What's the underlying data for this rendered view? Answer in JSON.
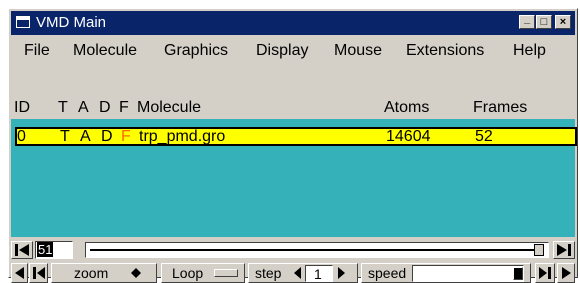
{
  "window": {
    "title": "VMD Main"
  },
  "titlebar_buttons": [
    "_",
    "□",
    "×"
  ],
  "menu": [
    "File",
    "Molecule",
    "Graphics",
    "Display",
    "Mouse",
    "Extensions",
    "Help"
  ],
  "columns": {
    "id": "ID",
    "t": "T",
    "a": "A",
    "d": "D",
    "f": "F",
    "molecule": "Molecule",
    "atoms": "Atoms",
    "frames": "Frames"
  },
  "molecules": [
    {
      "id": "0",
      "t": "T",
      "a": "A",
      "d": "D",
      "f": "F",
      "molecule": "trp_pmd.gro",
      "atoms": "14604",
      "frames": "52"
    }
  ],
  "scrubber": {
    "frame": "51",
    "position_fraction": 0.98
  },
  "controls": {
    "zoom_label": "zoom",
    "loop_label": "Loop",
    "step_label": "step",
    "step_value": "1",
    "speed_label": "speed"
  },
  "colors": {
    "titlebar": "#0a246a",
    "list_bg": "#35b2b9",
    "selected_row": "#ffff00",
    "f_flag": "#ff6a00"
  }
}
